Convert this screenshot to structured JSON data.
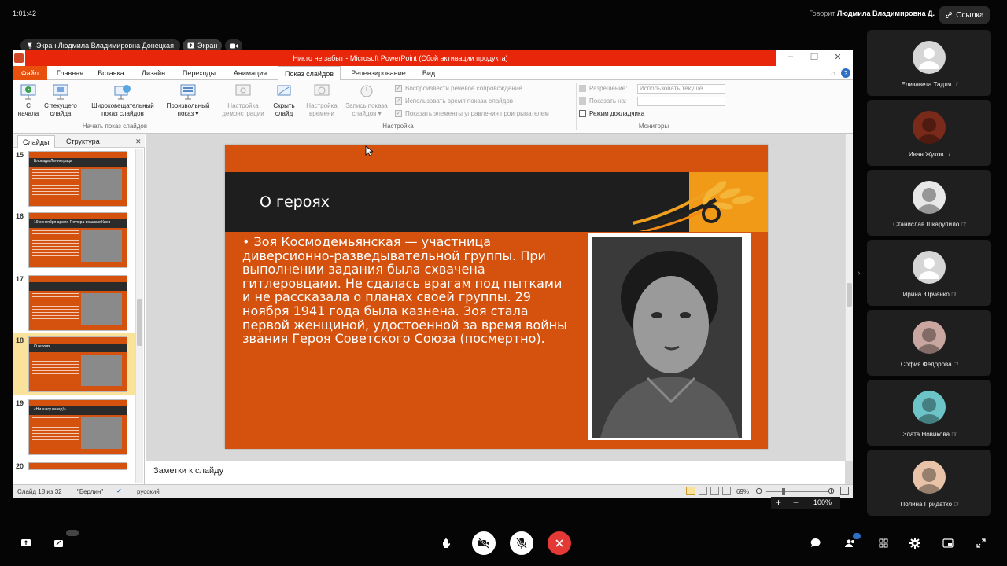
{
  "meeting": {
    "clock": "1:01:42",
    "speaker_prefix": "Говорит",
    "speaker_name": "Людмила Владимировна Д.",
    "link_label": "Ссылка",
    "share_owner_label": "Экран Людмила Владимировна Донецкая",
    "screen_label": "Экран"
  },
  "ppt": {
    "window_title": "Никто не забыт - Microsoft PowerPoint (Сбой активации продукта)",
    "tabs": [
      "Файл",
      "Главная",
      "Вставка",
      "Дизайн",
      "Переходы",
      "Анимация",
      "Показ слайдов",
      "Рецензирование",
      "Вид"
    ],
    "active_tab": "Показ слайдов",
    "ribbon": {
      "from_start": [
        "С",
        "начала"
      ],
      "from_current": [
        "С текущего",
        "слайда"
      ],
      "broadcast": [
        "Широковещательный",
        "показ слайдов"
      ],
      "custom": [
        "Произвольный",
        "показ"
      ],
      "group_start": "Начать показ слайдов",
      "setup": [
        "Настройка",
        "демонстрации"
      ],
      "hide": [
        "Скрыть",
        "слайд"
      ],
      "rehearse": [
        "Настройка",
        "времени"
      ],
      "record": [
        "Запись показа",
        "слайдов"
      ],
      "cb_narration": "Воспроизвести речевое сопровождение",
      "cb_timings": "Использовать время показа слайдов",
      "cb_controls": "Показать элементы управления проигрывателем",
      "group_setup": "Настройка",
      "resolution_label": "Разрешение:",
      "resolution_value": "Использовать текуще...",
      "show_on_label": "Показать на:",
      "presenter_view": "Режим докладчика",
      "group_monitors": "Мониторы"
    },
    "pane_tabs": [
      "Слайды",
      "Структура"
    ],
    "thumbs": [
      {
        "num": "15",
        "cap": "Блокада Ленинграда"
      },
      {
        "num": "16",
        "cap": "19 сентября армия Гитлера вошла в Киев"
      },
      {
        "num": "17",
        "cap": ""
      },
      {
        "num": "18",
        "cap": "О героях"
      },
      {
        "num": "19",
        "cap": "«Ни шагу назад!»"
      },
      {
        "num": "20",
        "cap": ""
      }
    ],
    "slide": {
      "title": "О героях",
      "body": "• Зоя Космодемьянская — участница диверсионно-разведывательной группы. При выполнении задания была схвачена гитлеровцами. Не сдалась врагам под пытками и не рассказала о планах своей группы. 29 ноября 1941 года была казнена. Зоя стала первой женщиной, удостоенной за время войны звания Героя Советского Союза (посмертно)."
    },
    "notes_placeholder": "Заметки к слайду",
    "status": {
      "slide_info": "Слайд 18 из 32",
      "theme": "\"Берлин\"",
      "language": "русский",
      "zoom": "69%"
    }
  },
  "viewer_zoom": "100%",
  "participants": [
    {
      "name": "Елизавета Тадля",
      "avatar": "default"
    },
    {
      "name": "Иван Жуков",
      "avatar": "photo"
    },
    {
      "name": "Станислав Шкарупило",
      "avatar": "photo"
    },
    {
      "name": "Ирина Юрченко",
      "avatar": "default"
    },
    {
      "name": "София Федорова",
      "avatar": "photo"
    },
    {
      "name": "Злата Новикова",
      "avatar": "photo"
    },
    {
      "name": "Полина Придатко",
      "avatar": "photo"
    }
  ],
  "colors": {
    "accent_red": "#e8260a",
    "slide_orange": "#d4520e",
    "end_call": "#e53935"
  }
}
